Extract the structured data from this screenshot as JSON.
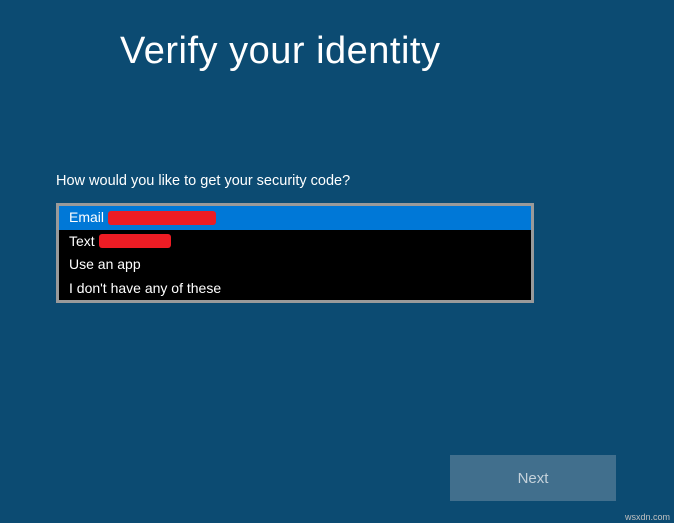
{
  "header": {
    "title": "Verify your identity"
  },
  "main": {
    "prompt": "How would you like to get your security code?",
    "options": [
      {
        "label": "Email",
        "redacted": true,
        "selected": true
      },
      {
        "label": "Text",
        "redacted": true,
        "selected": false
      },
      {
        "label": "Use an app",
        "redacted": false,
        "selected": false
      },
      {
        "label": "I don't have any of these",
        "redacted": false,
        "selected": false
      }
    ]
  },
  "footer": {
    "next_label": "Next"
  },
  "watermark": "wsxdn.com"
}
